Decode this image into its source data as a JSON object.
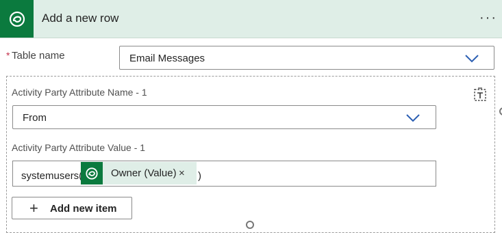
{
  "header": {
    "title": "Add a new row",
    "more_label": "···",
    "icon": "dataverse-logo-icon",
    "accent_color": "#0b7a3e",
    "background_color": "#dfeee7"
  },
  "table_name": {
    "required_marker": "*",
    "label": "Table name",
    "value": "Email Messages"
  },
  "activity_party": {
    "attribute_name": {
      "label": "Activity Party Attribute Name - 1",
      "value": "From"
    },
    "attribute_value": {
      "label": "Activity Party Attribute Value - 1",
      "prefix": "systemusers(",
      "token_label": "Owner (Value)",
      "token_close": "×",
      "suffix": ")"
    },
    "delete_icon": "delete-item-icon"
  },
  "add_item": {
    "plus": "+",
    "label": "Add new item"
  }
}
